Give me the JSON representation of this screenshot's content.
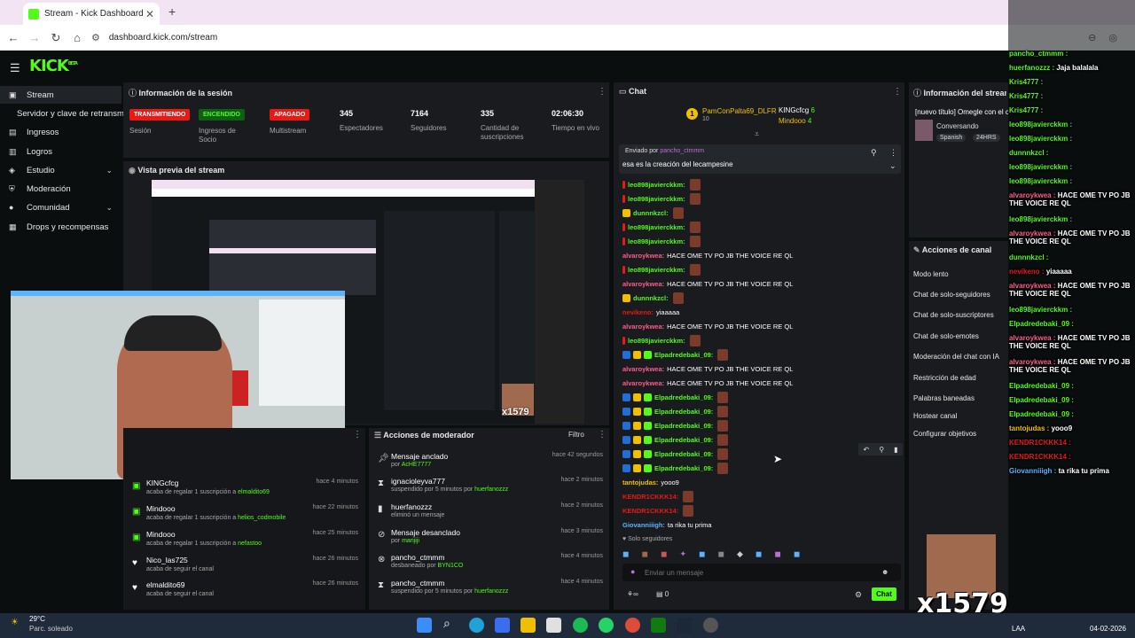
{
  "browser": {
    "tab_title": "Stream - Kick Dashboard",
    "url": "dashboard.kick.com/stream"
  },
  "kick": {
    "logo": "KICK",
    "logo_tag": "BETA"
  },
  "sidebar": {
    "items": [
      {
        "label": "Stream",
        "icon": "cast-icon"
      },
      {
        "label": "Servidor y clave de retransmisión",
        "icon": ""
      },
      {
        "label": "Ingresos",
        "icon": "money-icon"
      },
      {
        "label": "Logros",
        "icon": "trophy-icon"
      },
      {
        "label": "Estudio",
        "icon": "studio-icon"
      },
      {
        "label": "Moderación",
        "icon": "shield-icon"
      },
      {
        "label": "Comunidad",
        "icon": "people-icon"
      },
      {
        "label": "Drops y recompensas",
        "icon": "gift-icon"
      }
    ]
  },
  "session": {
    "title": "Información de la sesión",
    "stats": [
      {
        "badge": "TRANSMITIENDO",
        "label": "Sesión",
        "color": "#e91916"
      },
      {
        "badge": "ENCENDIDO",
        "label": "Ingresos de Socio",
        "color": "#0f5e16"
      },
      {
        "badge": "APAGADO",
        "label": "Multistream",
        "color": "#e91916"
      },
      {
        "value": "345",
        "label": "Espectadores"
      },
      {
        "value": "7164",
        "label": "Seguidores"
      },
      {
        "value": "335",
        "label": "Cantidad de suscripciones"
      },
      {
        "value": "02:06:30",
        "label": "Tiempo en vivo"
      }
    ]
  },
  "preview": {
    "title": "Vista previa del stream"
  },
  "activity": [
    {
      "name": "KINGcfcg",
      "desc": "acaba de regalar 1 suscripción a ",
      "target": "elmaldito69",
      "time": "hace 4 minutos"
    },
    {
      "name": "Mindooo",
      "desc": "acaba de regalar 1 suscripción a ",
      "target": "helios_codmobile",
      "time": "hace 22 minutos"
    },
    {
      "name": "Mindooo",
      "desc": "acaba de regalar 1 suscripción a ",
      "target": "nefastoo",
      "time": "hace 25 minutos"
    },
    {
      "name": "Nico_las725",
      "desc": "acaba de seguir el canal",
      "target": "",
      "time": "hace 26 minutos"
    },
    {
      "name": "elmaldito69",
      "desc": "acaba de seguir el canal",
      "target": "",
      "time": "hace 26 minutos"
    }
  ],
  "mod_actions": {
    "title": "Acciones de moderador",
    "filter": "Filtro",
    "rows": [
      {
        "icon": "pin-icon",
        "name": "Mensaje anclado",
        "desc": "por ",
        "target": "AcHE7777",
        "time": "hace 42 segundos"
      },
      {
        "icon": "timeout-icon",
        "name": "ignacioleyva777",
        "desc": "suspendido por 5 minutos por ",
        "target": "huerfanozzz",
        "time": "hace 2 minutos"
      },
      {
        "icon": "delete-icon",
        "name": "huerfanozzz",
        "desc": "eliminó un mensaje",
        "target": "",
        "time": "hace 2 minutos"
      },
      {
        "icon": "unpin-icon",
        "name": "Mensaje desanclado",
        "desc": "por ",
        "target": "marijiji",
        "time": "hace 3 minutos"
      },
      {
        "icon": "unban-icon",
        "name": "pancho_ctmmm",
        "desc": "desbaneado por ",
        "target": "BYN1CO",
        "time": "hace 4 minutos"
      },
      {
        "icon": "timeout-icon",
        "name": "pancho_ctmmm",
        "desc": "suspendido por 5 minutos por ",
        "target": "huerfanozzz",
        "time": "hace 4 minutos"
      }
    ]
  },
  "chat": {
    "title": "Chat",
    "leaders": [
      {
        "name": "PamConPalta69_DLFR",
        "count": "10"
      },
      {
        "name": "KINGcfcg",
        "count": "6"
      },
      {
        "name": "Mindooo",
        "count": "4"
      }
    ],
    "pinned_by_label": "Enviado por",
    "pinned_by": "pancho_ctmmm",
    "pinned_msg": "esa es la creación del lecampesine",
    "messages": [
      {
        "user": "leo898javierckkm:",
        "text": "",
        "color": "#53fc18",
        "emote": true
      },
      {
        "user": "leo898javierckkm:",
        "text": "",
        "color": "#53fc18",
        "emote": true
      },
      {
        "user": "dunnnkzcl:",
        "text": "",
        "color": "#53fc18",
        "emote": true
      },
      {
        "user": "leo898javierckkm:",
        "text": "",
        "color": "#53fc18",
        "emote": true
      },
      {
        "user": "leo898javierckkm:",
        "text": "",
        "color": "#53fc18",
        "emote": true
      },
      {
        "user": "alvaroykwea:",
        "text": "HACE OME TV PO JB THE VOICE RE QL",
        "color": "#ff5c8a",
        "emote": false
      },
      {
        "user": "leo898javierckkm:",
        "text": "",
        "color": "#53fc18",
        "emote": true
      },
      {
        "user": "alvaroykwea:",
        "text": "HACE OME TV PO JB THE VOICE RE QL",
        "color": "#ff5c8a",
        "emote": false
      },
      {
        "user": "dunnnkzcl:",
        "text": "",
        "color": "#53fc18",
        "emote": true
      },
      {
        "user": "nevikeno:",
        "text": "yiaaaaa",
        "color": "#e91916",
        "emote": false
      },
      {
        "user": "alvaroykwea:",
        "text": "HACE OME TV PO JB THE VOICE RE QL",
        "color": "#ff5c8a",
        "emote": false
      },
      {
        "user": "leo898javierckkm:",
        "text": "",
        "color": "#53fc18",
        "emote": true
      },
      {
        "user": "Elpadredebaki_09:",
        "text": "",
        "color": "#53fc18",
        "emote": true
      },
      {
        "user": "alvaroykwea:",
        "text": "HACE OME TV PO JB THE VOICE RE QL",
        "color": "#ff5c8a",
        "emote": false
      },
      {
        "user": "alvaroykwea:",
        "text": "HACE OME TV PO JB THE VOICE RE QL",
        "color": "#ff5c8a",
        "emote": false
      },
      {
        "user": "Elpadredebaki_09:",
        "text": "",
        "color": "#53fc18",
        "emote": true
      },
      {
        "user": "Elpadredebaki_09:",
        "text": "",
        "color": "#53fc18",
        "emote": true
      },
      {
        "user": "Elpadredebaki_09:",
        "text": "",
        "color": "#53fc18",
        "emote": true
      },
      {
        "user": "Elpadredebaki_09:",
        "text": "",
        "color": "#53fc18",
        "emote": true
      },
      {
        "user": "Elpadredebaki_09:",
        "text": "",
        "color": "#53fc18",
        "emote": true
      },
      {
        "user": "Elpadredebaki_09:",
        "text": "",
        "color": "#53fc18",
        "emote": true
      },
      {
        "user": "tantojudas:",
        "text": "yooo9",
        "color": "#f0c000",
        "emote": false
      },
      {
        "user": "KENDR1CKKK14:",
        "text": "",
        "color": "#e91916",
        "emote": true
      },
      {
        "user": "KENDR1CKKK14:",
        "text": "",
        "color": "#e91916",
        "emote": true
      },
      {
        "user": "Giovanniiigh:",
        "text": "ta rika tu prima",
        "color": "#5ab4ff",
        "emote": false
      }
    ],
    "followers_only": "Solo seguidores",
    "input_placeholder": "Enviar un mensaje",
    "kicks_count": "0",
    "send_label": "Chat"
  },
  "stream_info": {
    "title": "Información del stream",
    "stream_title": "[nuevo título] Omegle con el chat",
    "category": "Conversando",
    "tags": [
      "Spanish",
      "24HRS"
    ]
  },
  "channel_actions": {
    "title": "Acciones de canal",
    "items": [
      "Modo lento",
      "Chat de solo-seguidores",
      "Chat de solo-suscriptores",
      "Chat de solo-emotes",
      "Moderación del chat con IA",
      "Restricción de edad",
      "Palabras baneadas",
      "Hostear canal",
      "Configurar objetivos"
    ]
  },
  "overlay_chat": [
    {
      "user": "pancho_ctmmm :",
      "color": "#53fc18"
    },
    {
      "user": "huerfanozzz :",
      "text": "Jaja balalala",
      "color": "#53fc18"
    },
    {
      "user": "Kris4777 :",
      "color": "#53fc18"
    },
    {
      "user": "Kris4777 :",
      "color": "#53fc18"
    },
    {
      "user": "Kris4777 :",
      "color": "#53fc18"
    },
    {
      "user": "leo898javierckkm :",
      "color": "#53fc18"
    },
    {
      "user": "leo898javierckkm :",
      "color": "#53fc18"
    },
    {
      "user": "dunnnkzcl :",
      "color": "#53fc18"
    },
    {
      "user": "leo898javierckkm :",
      "color": "#53fc18"
    },
    {
      "user": "leo898javierckkm :",
      "color": "#53fc18"
    },
    {
      "user": "alvaroykwea :",
      "text": "HACE OME TV PO JB THE VOICE RE QL",
      "color": "#ff5c8a"
    },
    {
      "user": "leo898javierckkm :",
      "color": "#53fc18"
    },
    {
      "user": "alvaroykwea :",
      "text": "HACE OME TV PO JB THE VOICE RE QL",
      "color": "#ff5c8a"
    },
    {
      "user": "dunnnkzcl :",
      "color": "#53fc18"
    },
    {
      "user": "nevikeno :",
      "text": "yiaaaaa",
      "color": "#e91916"
    },
    {
      "user": "alvaroykwea :",
      "text": "HACE OME TV PO JB THE VOICE RE QL",
      "color": "#ff5c8a"
    },
    {
      "user": "leo898javierckkm :",
      "color": "#53fc18"
    },
    {
      "user": "Elpadredebaki_09 :",
      "color": "#53fc18"
    },
    {
      "user": "alvaroykwea :",
      "text": "HACE OME TV PO JB THE VOICE RE QL",
      "color": "#ff5c8a"
    },
    {
      "user": "alvaroykwea :",
      "text": "HACE OME TV PO JB THE VOICE RE QL",
      "color": "#ff5c8a"
    },
    {
      "user": "Elpadredebaki_09 :",
      "color": "#53fc18"
    },
    {
      "user": "Elpadredebaki_09 :",
      "color": "#53fc18"
    },
    {
      "user": "Elpadredebaki_09 :",
      "color": "#53fc18"
    },
    {
      "user": "tantojudas :",
      "text": "yooo9",
      "color": "#f0c000"
    },
    {
      "user": "KENDR1CKKK14 :",
      "color": "#e91916"
    },
    {
      "user": "KENDR1CKKK14 :",
      "color": "#e91916"
    },
    {
      "user": "Giovanniiigh :",
      "text": "ta rika tu prima",
      "color": "#5ab4ff"
    }
  ],
  "overlay_sticker": "x1579",
  "preview_sticker": "x1579",
  "taskbar": {
    "weather_temp": "29°C",
    "weather_desc": "Parc. soleado",
    "lang": "LAA",
    "date": "04-02-2026"
  },
  "colors": {
    "accent": "#53fc18",
    "panel": "#191b1f",
    "bg": "#0b0e0f"
  }
}
